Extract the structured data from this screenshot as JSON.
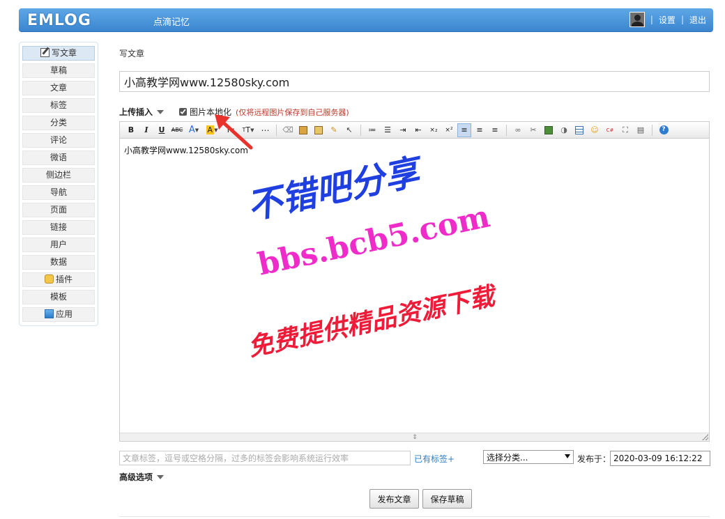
{
  "header": {
    "logo": "EMLOG",
    "blog_name": "点滴记忆",
    "settings": "设置",
    "logout": "退出",
    "separator": "|"
  },
  "sidebar": {
    "items": [
      {
        "label": "写文章",
        "icon": "write-icon",
        "active": true
      },
      {
        "label": "草稿"
      },
      {
        "label": "文章"
      },
      {
        "label": "标签"
      },
      {
        "label": "分类"
      },
      {
        "label": "评论"
      },
      {
        "label": "微语"
      },
      {
        "label": "侧边栏"
      },
      {
        "label": "导航"
      },
      {
        "label": "页面"
      },
      {
        "label": "链接"
      },
      {
        "label": "用户"
      },
      {
        "label": "数据"
      },
      {
        "label": "插件",
        "icon": "plugin-icon"
      },
      {
        "label": "模板"
      },
      {
        "label": "应用",
        "icon": "app-icon"
      }
    ]
  },
  "main": {
    "page_title": "写文章",
    "title_value": "小高教学网www.12580sky.com",
    "upload_insert": "上传插入",
    "localize_label": "图片本地化",
    "localize_note": "(仅将远程图片保存到自己服务器)",
    "localize_checked": true,
    "editor_content": "小高教学网www.12580sky.com",
    "toolbar": {
      "bold": "B",
      "italic": "I",
      "underline": "U",
      "strike": "ABC",
      "font_color": "A",
      "highlight": "A",
      "font_size": "T",
      "line_height": "T"
    },
    "tag_placeholder": "文章标签，逗号或空格分隔，过多的标签会影响系统运行效率",
    "existing_tags": "已有标签+",
    "category_selected": "选择分类...",
    "publish_at_label": "发布于：",
    "publish_date": "2020-03-09 16:12:22",
    "advanced_options": "高级选项",
    "publish_button": "发布文章",
    "save_draft_button": "保存草稿"
  },
  "watermark": {
    "line1": "不错吧分享",
    "line2": "bbs.bcb5.com",
    "line3": "免费提供精品资源下载"
  },
  "colors": {
    "header_blue": "#3b86d0",
    "note_red": "#c0392b",
    "link_blue": "#2f80c5",
    "arrow_red": "#e8322b"
  }
}
